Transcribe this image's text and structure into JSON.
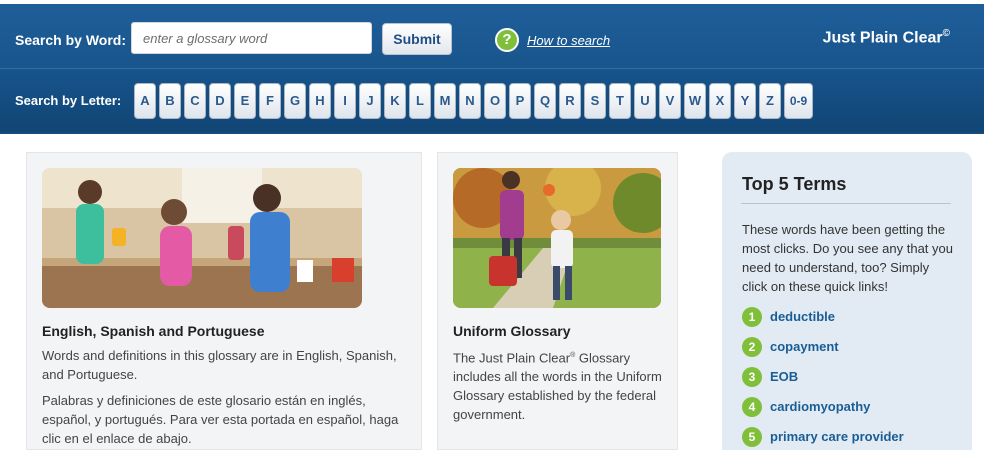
{
  "header": {
    "search_label": "Search by Word:",
    "search_placeholder": "enter a glossary word",
    "submit_label": "Submit",
    "help_icon": "?",
    "help_link": "How to search",
    "brand": "Just Plain Clear",
    "brand_mark": "©",
    "letter_label": "Search by Letter:",
    "letters": [
      "A",
      "B",
      "C",
      "D",
      "E",
      "F",
      "G",
      "H",
      "I",
      "J",
      "K",
      "L",
      "M",
      "N",
      "O",
      "P",
      "Q",
      "R",
      "S",
      "T",
      "U",
      "V",
      "W",
      "X",
      "Y",
      "Z",
      "0-9"
    ]
  },
  "cards": [
    {
      "title": "English, Spanish and Portuguese",
      "text1": "Words and definitions in this glossary are in English, Spanish, and Portuguese.",
      "text2": "Palabras y definiciones de este glosario están en inglés, español, y portugués. Para ver esta portada en español, haga clic en el enlace de abajo."
    },
    {
      "title": "Uniform Glossary",
      "text_prefix": "The Just Plain Clear",
      "text_mark": "®",
      "text_suffix": " Glossary includes all the words in the Uniform Glossary established by the federal government."
    }
  ],
  "top5": {
    "title": "Top 5 Terms",
    "intro": "These words have been getting the most clicks. Do you see any that you need to understand, too? Simply click on these quick links!",
    "terms": [
      {
        "num": "1",
        "label": "deductible"
      },
      {
        "num": "2",
        "label": "copayment"
      },
      {
        "num": "3",
        "label": "EOB"
      },
      {
        "num": "4",
        "label": "cardiomyopathy"
      },
      {
        "num": "5",
        "label": "primary care provider"
      }
    ]
  },
  "colors": {
    "header_blue": "#1e5e99",
    "accent_green": "#7fbf3a",
    "link_blue": "#1a5d95"
  }
}
